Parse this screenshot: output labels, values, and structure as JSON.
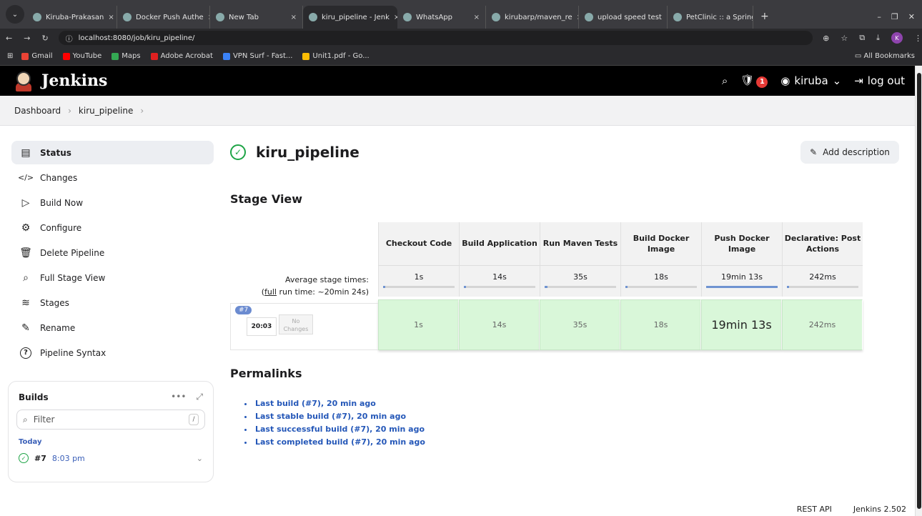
{
  "browser": {
    "tabs": [
      {
        "label": "Kiruba-Prakasan",
        "active": false
      },
      {
        "label": "Docker Push Authe",
        "active": false
      },
      {
        "label": "New Tab",
        "active": false
      },
      {
        "label": "kiru_pipeline - Jenk",
        "active": true
      },
      {
        "label": "WhatsApp",
        "active": false
      },
      {
        "label": "kirubarp/maven_re",
        "active": false
      },
      {
        "label": "upload speed test",
        "active": false
      },
      {
        "label": "PetClinic :: a Spring",
        "active": false
      }
    ],
    "url": "localhost:8080/job/kiru_pipeline/",
    "profile_initial": "K",
    "bookmarks": [
      {
        "label": "Gmail",
        "color": "#ea4335"
      },
      {
        "label": "YouTube",
        "color": "#ff0000"
      },
      {
        "label": "Maps",
        "color": "#34a853"
      },
      {
        "label": "Adobe Acrobat",
        "color": "#e02020"
      },
      {
        "label": "VPN Surf - Fast...",
        "color": "#3b82f6"
      },
      {
        "label": "Unit1.pdf - Go...",
        "color": "#fbbc04"
      }
    ],
    "all_bookmarks": "All Bookmarks"
  },
  "header": {
    "title": "Jenkins",
    "notification_count": "1",
    "user": "kiruba",
    "logout": "log out"
  },
  "breadcrumb": [
    "Dashboard",
    "kiru_pipeline"
  ],
  "sidebar": {
    "items": [
      {
        "label": "Status",
        "icon": "document-icon",
        "glyph": "▤",
        "active": true
      },
      {
        "label": "Changes",
        "icon": "code-icon",
        "glyph": "</>",
        "active": false
      },
      {
        "label": "Build Now",
        "icon": "play-icon",
        "glyph": "▷",
        "active": false
      },
      {
        "label": "Configure",
        "icon": "gear-icon",
        "glyph": "⚙",
        "active": false
      },
      {
        "label": "Delete Pipeline",
        "icon": "trash-icon",
        "glyph": "🗑",
        "active": false
      },
      {
        "label": "Full Stage View",
        "icon": "search-icon",
        "glyph": "⌕",
        "active": false
      },
      {
        "label": "Stages",
        "icon": "layers-icon",
        "glyph": "≋",
        "active": false
      },
      {
        "label": "Rename",
        "icon": "pencil-icon",
        "glyph": "✎",
        "active": false
      },
      {
        "label": "Pipeline Syntax",
        "icon": "help-icon",
        "glyph": "?",
        "active": false
      }
    ]
  },
  "builds": {
    "title": "Builds",
    "filter_placeholder": "Filter",
    "group": "Today",
    "items": [
      {
        "number": "#7",
        "time": "8:03 pm"
      }
    ]
  },
  "main": {
    "title": "kiru_pipeline",
    "add_description": "Add description",
    "stage_view_title": "Stage View",
    "permalinks_title": "Permalinks"
  },
  "stage_view": {
    "stages": [
      {
        "name": "Checkout Code",
        "avg": "1s",
        "run": "1s",
        "avg_fraction": 0.01,
        "emphasized": false
      },
      {
        "name": "Build Application",
        "avg": "14s",
        "run": "14s",
        "avg_fraction": 0.02,
        "emphasized": false
      },
      {
        "name": "Run Maven Tests",
        "avg": "35s",
        "run": "35s",
        "avg_fraction": 0.04,
        "emphasized": false
      },
      {
        "name": "Build Docker Image",
        "avg": "18s",
        "run": "18s",
        "avg_fraction": 0.02,
        "emphasized": false
      },
      {
        "name": "Push Docker Image",
        "avg": "19min 13s",
        "run": "19min 13s",
        "avg_fraction": 1.0,
        "emphasized": true
      },
      {
        "name": "Declarative: Post Actions",
        "avg": "242ms",
        "run": "242ms",
        "avg_fraction": 0.003,
        "emphasized": false
      }
    ],
    "avg_label": "Average stage times:",
    "full_run_prefix": "full",
    "full_run_suffix": " run time: ~20min 24s)",
    "build": {
      "number": "#7",
      "time": "20:03",
      "changes_line1": "No",
      "changes_line2": "Changes"
    }
  },
  "permalinks": [
    "Last build (#7), 20 min ago",
    "Last stable build (#7), 20 min ago",
    "Last successful build (#7), 20 min ago",
    "Last completed build (#7), 20 min ago"
  ],
  "footer": {
    "rest_api": "REST API",
    "version": "Jenkins 2.502"
  }
}
